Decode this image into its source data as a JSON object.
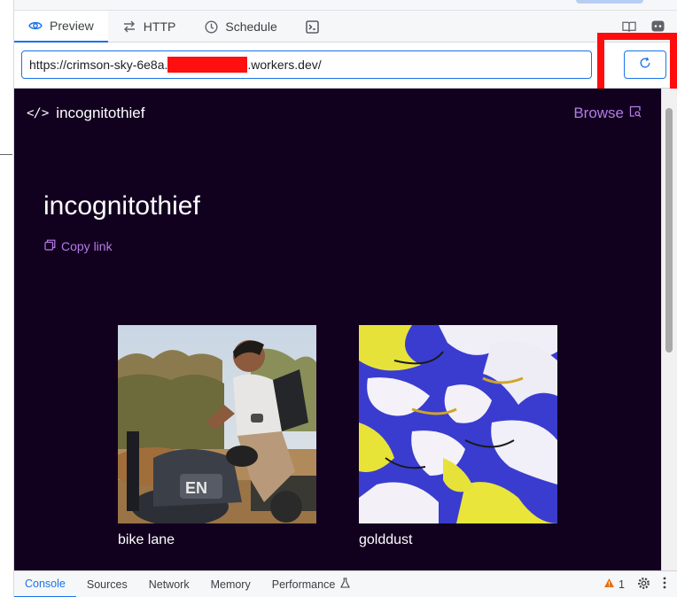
{
  "tabs": [
    {
      "label": "Preview",
      "icon": "eye-icon",
      "active": true
    },
    {
      "label": "HTTP",
      "icon": "swap-arrows-icon"
    },
    {
      "label": "Schedule",
      "icon": "clock-icon"
    },
    {
      "label": "",
      "icon": "terminal-icon"
    }
  ],
  "toolbar_right_icons": [
    "book-icon",
    "discord-icon"
  ],
  "url": {
    "prefix": "https://crimson-sky-6e8a.",
    "suffix": ".workers.dev/"
  },
  "refresh_icon": "refresh-icon",
  "site": {
    "name": "incognitothief",
    "browse_label": "Browse",
    "title": "incognitothief",
    "copy_link_label": "Copy link",
    "cards": [
      {
        "caption": "bike lane"
      },
      {
        "caption": "golddust"
      }
    ]
  },
  "devtools": {
    "tabs": [
      "Console",
      "Sources",
      "Network",
      "Memory",
      "Performance"
    ],
    "active_tab": "Console",
    "warning_count": "1"
  },
  "colors": {
    "accent": "#1a73e8",
    "preview_bg": "#12001f",
    "link_purple": "#b47ce6",
    "highlight_red": "#ff0d0d"
  }
}
